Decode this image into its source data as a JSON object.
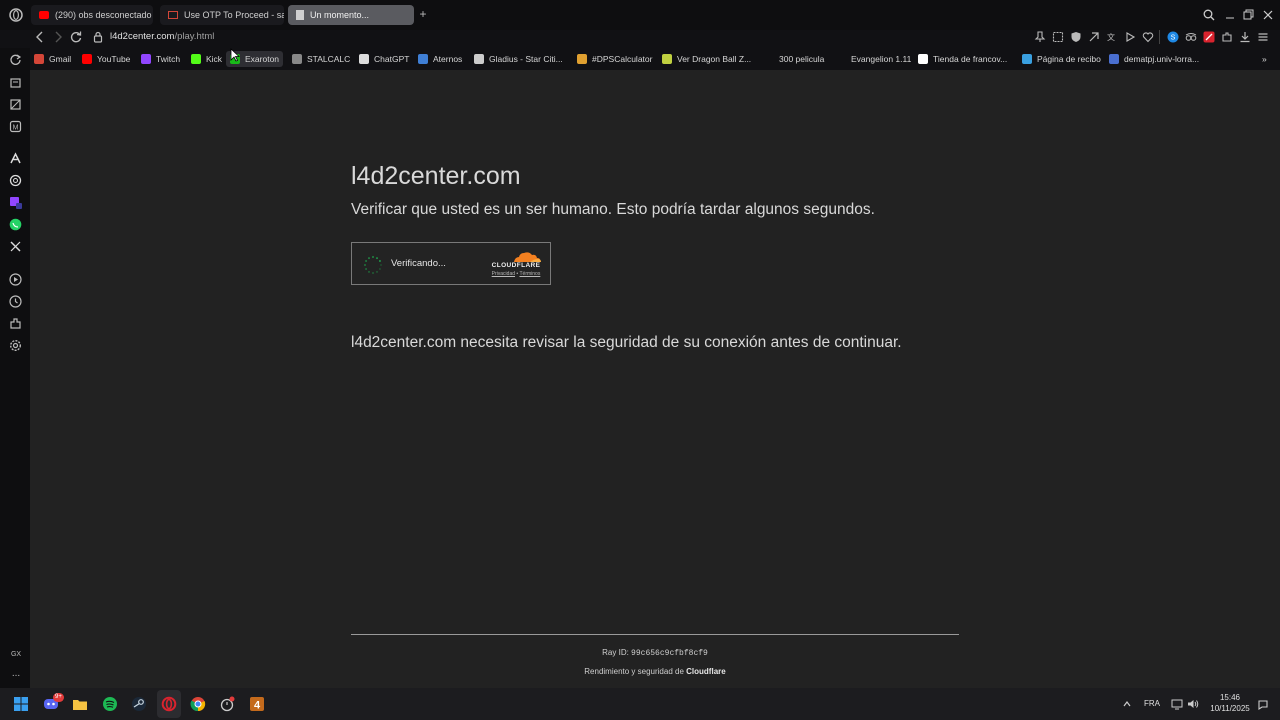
{
  "browser": {
    "tabs": [
      {
        "label": "(290) obs desconectado",
        "icon": "youtube-icon",
        "state": "inactive"
      },
      {
        "label": "Use OTP To Proceed - sa",
        "icon": "gmail-icon",
        "state": "inactive"
      },
      {
        "label": "Un momento...",
        "icon": "page-icon",
        "state": "active"
      }
    ],
    "new_tab_label": "+",
    "url_host": "l4d2center.com",
    "url_path": "/play.html"
  },
  "bookmarks": [
    {
      "label": "Gmail",
      "icon": "gmail-icon",
      "color": "#d44638"
    },
    {
      "label": "YouTube",
      "icon": "youtube-icon",
      "color": "#ff0000"
    },
    {
      "label": "Twitch",
      "icon": "twitch-icon",
      "color": "#9146ff"
    },
    {
      "label": "Kick",
      "icon": "kick-icon",
      "color": "#53fc18"
    },
    {
      "label": "Exaroton",
      "icon": "exaroton-icon",
      "color": "#19ba19"
    },
    {
      "label": "STALCALC",
      "icon": "stalcalc-icon",
      "color": "#888888"
    },
    {
      "label": "ChatGPT",
      "icon": "chatgpt-icon",
      "color": "#dddddd"
    },
    {
      "label": "Aternos",
      "icon": "aternos-icon",
      "color": "#3f7fd5"
    },
    {
      "label": "Gladius - Star Citi...",
      "icon": "gladius-icon",
      "color": "#cccccc"
    },
    {
      "label": "#DPSCalculator",
      "icon": "dps-icon",
      "color": "#e0a030"
    },
    {
      "label": "Ver Dragon Ball Z...",
      "icon": "dragonball-icon",
      "color": "#c0d040"
    },
    {
      "label": "300 pelicula",
      "icon": "",
      "color": ""
    },
    {
      "label": "Evangelion 1.11",
      "icon": "",
      "color": ""
    },
    {
      "label": "Tienda de francov...",
      "icon": "tienda-icon",
      "color": "#ffffff"
    },
    {
      "label": "Página de recibo",
      "icon": "recibo-icon",
      "color": "#3aa0e0"
    },
    {
      "label": "dematpj.univ-lorra...",
      "icon": "univ-icon",
      "color": "#4a6fd0"
    }
  ],
  "page": {
    "site_title": "l4d2center.com",
    "verify_text": "Verificar que usted es un ser humano. Esto podría tardar algunos segundos.",
    "widget": {
      "status": "Verificando...",
      "brand": "CLOUDFLARE",
      "privacy": "Privacidad",
      "separator": "•",
      "terms": "Términos"
    },
    "security_text": "l4d2center.com necesita revisar la seguridad de su conexión antes de continuar.",
    "ray_label": "Ray ID:",
    "ray_id": "99c656c9cfbf8cf9",
    "perf_label": "Rendimiento y seguridad de",
    "perf_brand": "Cloudflare"
  },
  "sidebar": {
    "gx_label": "GX",
    "more_label": "..."
  },
  "taskbar": {
    "language": "FRA",
    "time": "15:46",
    "date": "10/11/2025",
    "discord_badge": "9+"
  },
  "colors": {
    "accent_orange": "#f38020",
    "opera_red": "#d9232e",
    "spinner_green": "#1f9e4a"
  }
}
